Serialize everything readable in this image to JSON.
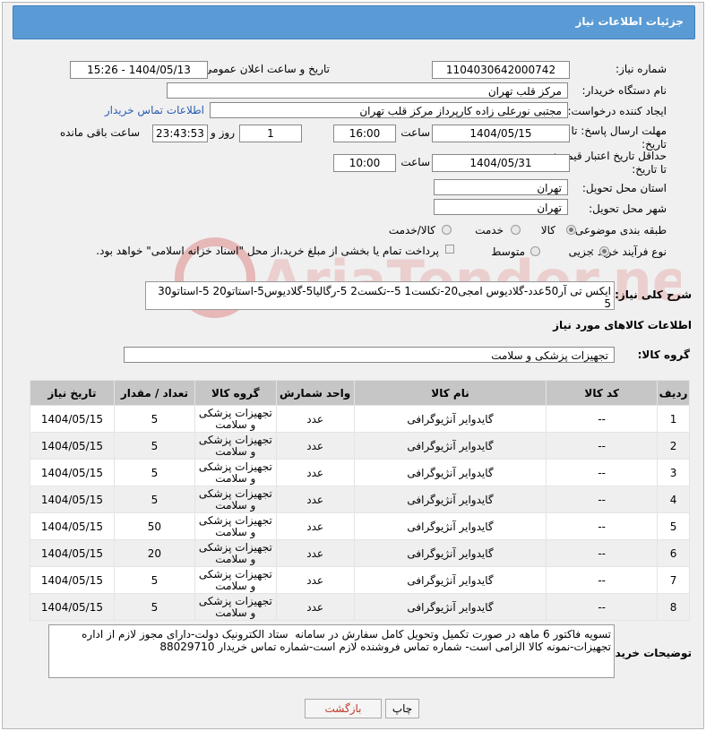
{
  "header": {
    "title": "جزئیات اطلاعات نیاز"
  },
  "form": {
    "need_number_label": "شماره نیاز:",
    "need_number": "1104030642000742",
    "announce_label": "تاریخ و ساعت اعلان عمومی:",
    "announce_value": "1404/05/13 - 15:26",
    "buyer_org_label": "نام دستگاه خریدار:",
    "buyer_org": "مرکز قلب تهران",
    "creator_label": "ایجاد کننده درخواست:",
    "creator": "مجتبی نورعلی زاده کارپرداز مرکز قلب تهران",
    "contact_link": "اطلاعات تماس خریدار",
    "deadline_label": "مهلت ارسال پاسخ: تا تاریخ:",
    "deadline_date": "1404/05/15",
    "time_label": "ساعت",
    "deadline_time": "16:00",
    "days_value": "1",
    "days_label": "روز و",
    "remaining_value": "23:43:53",
    "remaining_label": "ساعت باقی مانده",
    "validity_label": "حداقل تاریخ اعتبار قیمت: تا تاریخ:",
    "validity_date": "1404/05/31",
    "validity_time": "10:00",
    "province_label": "استان محل تحویل:",
    "province": "تهران",
    "city_label": "شهر محل تحویل:",
    "city": "تهران",
    "category_label": "طبقه بندی موضوعی:",
    "category_options": [
      "کالا",
      "خدمت",
      "کالا/خدمت"
    ],
    "process_label": "نوع فرآیند خرید :",
    "process_options": [
      "جزیی",
      "متوسط"
    ],
    "payment_note": "پرداخت تمام یا بخشی از مبلغ خرید،از محل \"اسناد خزانه اسلامی\" خواهد بود.",
    "summary_label": "شرح کلی نیاز:",
    "summary": "ایکس تی آر50عدد-گلادیوس امجی20-تکست1 5--تکست2 5-رگالیا5-گلادیوس5-استاتو20 5-استاتو30 5",
    "goods_info_title": "اطلاعات کالاهای مورد نیاز",
    "goods_group_label": "گروه کالا:",
    "goods_group": "تجهیزات پزشکی و سلامت",
    "buyer_notes_label": "توضیحات خریدار:",
    "buyer_notes": "تسویه فاکتور 6 ماهه در صورت تکمیل وتحویل کامل سفارش در سامانه  ستاد الکترونیک دولت-دارای مجوز لازم از اداره تجهیزات-نمونه کالا الزامی است- شماره تماس فروشنده لازم است-شماره تماس خریدار 88029710"
  },
  "table": {
    "headers": [
      "ردیف",
      "کد کالا",
      "نام کالا",
      "واحد شمارش",
      "گروه کالا",
      "تعداد / مقدار",
      "تاریخ نیاز"
    ],
    "rows": [
      [
        "1",
        "--",
        "گایدوایر آنژیوگرافی",
        "عدد",
        "تجهیزات پزشکی و سلامت",
        "5",
        "1404/05/15"
      ],
      [
        "2",
        "--",
        "گایدوایر آنژیوگرافی",
        "عدد",
        "تجهیزات پزشکی و سلامت",
        "5",
        "1404/05/15"
      ],
      [
        "3",
        "--",
        "گایدوایر آنژیوگرافی",
        "عدد",
        "تجهیزات پزشکی و سلامت",
        "5",
        "1404/05/15"
      ],
      [
        "4",
        "--",
        "گایدوایر آنژیوگرافی",
        "عدد",
        "تجهیزات پزشکی و سلامت",
        "5",
        "1404/05/15"
      ],
      [
        "5",
        "--",
        "گایدوایر آنژیوگرافی",
        "عدد",
        "تجهیزات پزشکی و سلامت",
        "50",
        "1404/05/15"
      ],
      [
        "6",
        "--",
        "گایدوایر آنژیوگرافی",
        "عدد",
        "تجهیزات پزشکی و سلامت",
        "20",
        "1404/05/15"
      ],
      [
        "7",
        "--",
        "گایدوایر آنژیوگرافی",
        "عدد",
        "تجهیزات پزشکی و سلامت",
        "5",
        "1404/05/15"
      ],
      [
        "8",
        "--",
        "گایدوایر آنژیوگرافی",
        "عدد",
        "تجهیزات پزشکی و سلامت",
        "5",
        "1404/05/15"
      ]
    ]
  },
  "buttons": {
    "print": "چاپ",
    "back": "بازگشت"
  },
  "watermark": {
    "text": "AriaTender.net"
  },
  "colors": {
    "header_bg": "#5a9bd5",
    "link": "#2a5db0",
    "back_text": "#c0392b",
    "watermark": "#e6b8b8"
  }
}
